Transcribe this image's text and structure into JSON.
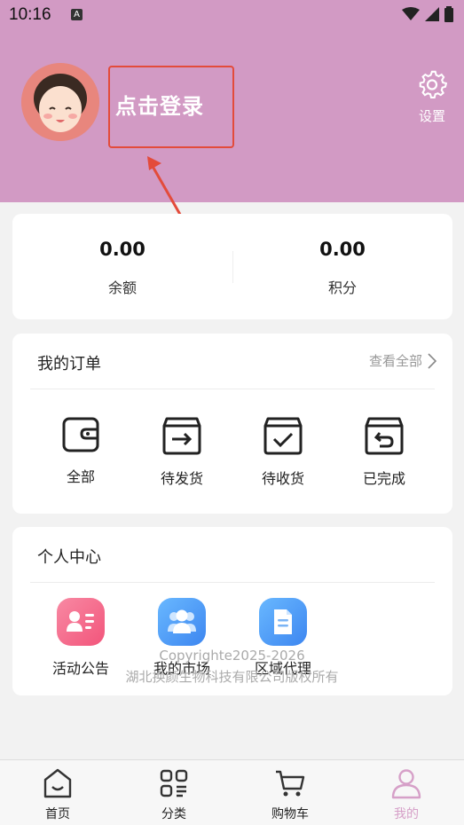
{
  "status_bar": {
    "time": "10:16",
    "notification_icon": "A"
  },
  "colors": {
    "header": "#d29ac4",
    "accent": "#d6a0c8",
    "annotation": "#e34b3b"
  },
  "profile": {
    "login_label": "点击登录",
    "settings_label": "设置"
  },
  "balance": {
    "items": [
      {
        "value": "0.00",
        "label": "余额"
      },
      {
        "value": "0.00",
        "label": "积分"
      }
    ]
  },
  "orders": {
    "title": "我的订单",
    "view_all": "查看全部",
    "items": [
      {
        "label": "全部",
        "icon": "wallet-icon"
      },
      {
        "label": "待发货",
        "icon": "box-out-icon"
      },
      {
        "label": "待收货",
        "icon": "box-check-icon"
      },
      {
        "label": "已完成",
        "icon": "box-return-icon"
      }
    ]
  },
  "personal": {
    "title": "个人中心",
    "items": [
      {
        "label": "活动公告",
        "icon": "contact-card-icon"
      },
      {
        "label": "我的市场",
        "icon": "users-icon"
      },
      {
        "label": "区域代理",
        "icon": "document-icon"
      }
    ]
  },
  "footer": {
    "copyright": "Copyrighte2025-2026",
    "company": "湖北换颜生物科技有限公司版权所有"
  },
  "tabbar": {
    "items": [
      {
        "label": "首页",
        "icon": "home-icon"
      },
      {
        "label": "分类",
        "icon": "category-icon"
      },
      {
        "label": "购物车",
        "icon": "cart-icon"
      },
      {
        "label": "我的",
        "icon": "user-icon",
        "active": true
      }
    ]
  }
}
